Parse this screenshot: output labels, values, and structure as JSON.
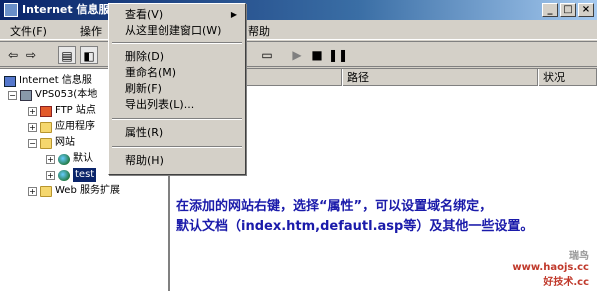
{
  "window": {
    "title": "Internet 信息服"
  },
  "menubar": {
    "items": [
      "文件(F)",
      "操作",
      "帮助"
    ]
  },
  "tree": {
    "root": "Internet 信息服",
    "server": "VPS053(本地",
    "ftp": "FTP 站点",
    "apppools": "应用程序",
    "websites": "网站",
    "default": "默认",
    "test": "test",
    "webext": "Web 服务扩展"
  },
  "list": {
    "columns": [
      "路径",
      "状况"
    ]
  },
  "context_menu": {
    "view": "查看(V)",
    "new_window": "从这里创建窗口(W)",
    "delete": "删除(D)",
    "rename": "重命名(M)",
    "refresh": "刷新(F)",
    "export": "导出列表(L)...",
    "properties": "属性(R)",
    "help": "帮助(H)"
  },
  "note": {
    "line1": "在添加的网站右键，选择“属性”，可以设置域名绑定，",
    "line2": "默认文档（index.htm,defautl.asp等）及其他一些设置。"
  },
  "watermark": {
    "a": "瑞鸟",
    "b": "www.haojs.cc",
    "c": "好技术.cc"
  }
}
